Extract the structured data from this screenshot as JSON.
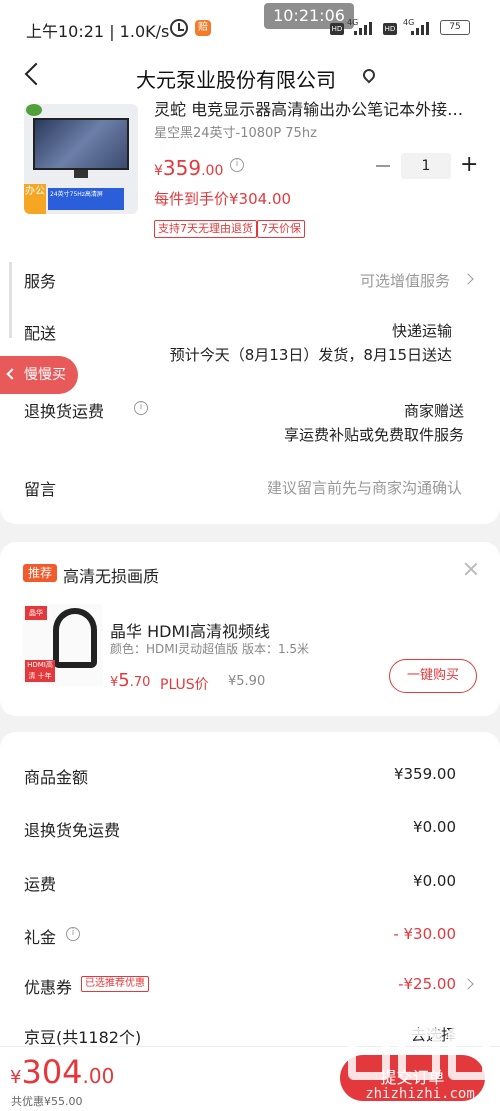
{
  "status_bar": {
    "time_text": "上午10:21 | 1.0K/s",
    "center_time": "10:21:06",
    "net1": "4G",
    "net2": "4G",
    "hd1": "HD",
    "hd2": "HD",
    "battery": "75",
    "app_badge": "赔"
  },
  "header": {
    "title": "大元泵业股份有限公司"
  },
  "product": {
    "title": "灵蛇 电竞显示器高清输出办公笔记本外接…",
    "spec": "星空黑24英寸-1080P 75hz",
    "price_currency": "¥",
    "price_int": "359",
    "price_dec": ".00",
    "final_price": "每件到手价¥304.00",
    "quantity": "1",
    "tags": [
      "支持7天无理由退货",
      "7天价保"
    ],
    "img_tag": "办公",
    "img_spec": "24英寸75Hz高清屏"
  },
  "rows": {
    "service_label": "服务",
    "service_value": "可选增值服务",
    "delivery_label": "配送",
    "delivery_method": "快递运输",
    "delivery_eta": "预计今天（8月13日）发货，8月15日送达",
    "return_label": "退换货运费",
    "return_line1": "商家赠送",
    "return_line2": "享运费补贴或免费取件服务",
    "note_label": "留言",
    "note_placeholder": "建议留言前先与商家沟通确认"
  },
  "slow_buy": "慢慢买",
  "recommend": {
    "tag": "推荐",
    "title": "高清无损画质",
    "name": "晶华 HDMI高清视频线",
    "spec": "颜色：HDMI灵动超值版   版本：1.5米",
    "price_currency": "¥",
    "price_int": "5",
    "price_dec": ".70",
    "plus_label": "PLUS价",
    "orig_price": "¥5.90",
    "buy_label": "一键购买",
    "img_badge1": "晶华",
    "img_badge2": "HDMI高清 十年换新"
  },
  "summary": {
    "items": [
      {
        "label": "商品金额",
        "value": "¥359.00"
      },
      {
        "label": "退换货免运费",
        "value": "¥0.00"
      },
      {
        "label": "运费",
        "value": "¥0.00"
      },
      {
        "label": "礼金",
        "value": "- ¥30.00"
      },
      {
        "label": "优惠券",
        "value": "-¥25.00"
      },
      {
        "label": "京豆(共1182个)",
        "value": "去选择"
      }
    ],
    "coupon_tag": "已选推荐优惠"
  },
  "bottom": {
    "total_currency": "¥",
    "total_int": "304",
    "total_dec": ".00",
    "discount": "共优惠¥55.00",
    "submit": "提交订单",
    "watermark": "zhizhizhi.com"
  },
  "colors": {
    "accent": "#e4393c",
    "tag_orange": "#f15a2b"
  }
}
